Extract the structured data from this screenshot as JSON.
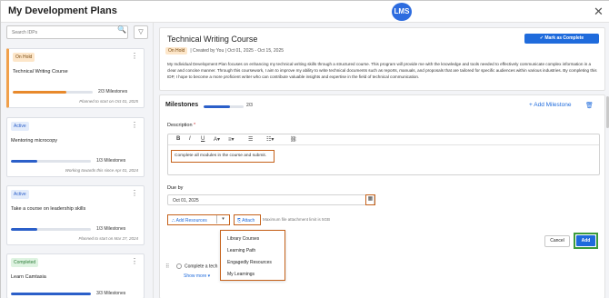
{
  "window": {
    "title": "My Development Plans",
    "logo_text": "LMS"
  },
  "sidebar": {
    "search_placeholder": "Search IDPs",
    "cards": [
      {
        "status": "On Hold",
        "name": "Technical Writing Course",
        "milestones": "2/3",
        "milestones_label": "Milestones",
        "progress": 0.67,
        "plan": "Planned to start on Oct 01, 2025",
        "color": "#e8892b"
      },
      {
        "status": "Active",
        "name": "Mentoring microcopy",
        "milestones": "1/3",
        "milestones_label": "Milestones",
        "progress": 0.33,
        "plan": "Working towards this since Apr 01, 2024",
        "color": "#2b5fc9"
      },
      {
        "status": "Active",
        "name": "Take a course on leadership skills",
        "milestones": "1/3",
        "milestones_label": "Milestones",
        "progress": 0.33,
        "plan": "Planned to start on Mar 27, 2024",
        "color": "#2b5fc9"
      },
      {
        "status": "Completed",
        "name": "Learn Camtasia",
        "milestones": "3/3",
        "milestones_label": "Milestones",
        "progress": 1.0,
        "plan": "",
        "color": "#2b5fc9"
      }
    ]
  },
  "course": {
    "title": "Technical Writing Course",
    "status": "On Hold",
    "meta": "| Created by You  | Oct 01, 2025 - Oct 15, 2025",
    "mark_complete": "Mark as Complete",
    "description": "My Individual Development Plan focuses on enhancing my technical writing skills through a structured course. This program will provide me with the knowledge and tools needed to effectively communicate complex information in a clear and concise manner. Through this coursework, I aim to improve my ability to write technical documents such as reports, manuals, and proposals that are tailored for specific audiences within various industries. By completing this IDP, I hope to become a more proficient writer who can contribute valuable insights and expertise in the field of technical communication."
  },
  "milestones": {
    "label": "Milestones",
    "count": "2/3",
    "progress": 0.67,
    "add_label": "+ Add Milestone",
    "description_label": "Description",
    "editor_text": "Complete all modules in the course and submit.",
    "due_label": "Due by",
    "due_value": "Oct 01, 2025",
    "add_resources": "Add Resources",
    "attach": "Attach",
    "max_size": "Maximum file attachment limit is 5GB",
    "menu": [
      "Library Courses",
      "Learning Path",
      "Engagedly Resources",
      "My Learnings"
    ],
    "cancel": "Cancel",
    "add": "Add",
    "collapsed_item": "Complete a tech",
    "show_more": "Show more"
  }
}
